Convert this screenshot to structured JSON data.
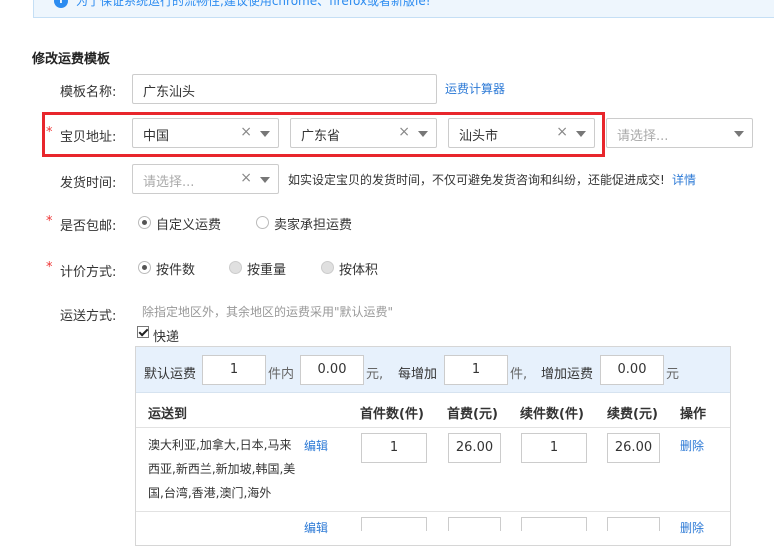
{
  "notice": {
    "text": "为了保证系统运行的流畅性,建议使用chrome、firefox或者新版ie!"
  },
  "section": {
    "title": "修改运费模板"
  },
  "form": {
    "template_name": {
      "label": "模板名称:",
      "value": "广东汕头",
      "link": "运费计算器"
    },
    "location": {
      "required_mark": "*",
      "label": "宝贝地址:",
      "country": "中国",
      "province": "广东省",
      "city": "汕头市",
      "district_placeholder": "请选择..."
    },
    "ship_time": {
      "label": "发货时间:",
      "placeholder": "请选择...",
      "note": "如实设定宝贝的发货时间，不仅可避免发货咨询和纠纷，还能促进成交!",
      "link": "详情"
    },
    "free_shipping": {
      "required_mark": "*",
      "label": "是否包邮:",
      "options": [
        "自定义运费",
        "卖家承担运费"
      ],
      "selected": 0
    },
    "pricing": {
      "required_mark": "*",
      "label": "计价方式:",
      "options": [
        "按件数",
        "按重量",
        "按体积"
      ],
      "selected": 0
    },
    "shipping_method": {
      "label": "运送方式:",
      "hint": "除指定地区外，其余地区的运费采用\"默认运费\"",
      "express_label": "快递",
      "express_checked": true
    }
  },
  "panel": {
    "default": {
      "label": "默认运费",
      "first_qty": "1",
      "unit_pieces": "件内",
      "first_fee": "0.00",
      "unit_yuan": "元,",
      "increase_label": "每增加",
      "add_qty": "1",
      "unit_piece": "件,",
      "add_fee_label": "增加运费",
      "add_fee": "0.00",
      "unit_yuan2": "元"
    },
    "headers": [
      "运送到",
      "首件数(件)",
      "首费(元)",
      "续件数(件)",
      "续费(元)",
      "操作"
    ],
    "rows": [
      {
        "regions": "澳大利亚,加拿大,日本,马来西亚,新西兰,新加坡,韩国,美国,台湾,香港,澳门,海外",
        "edit": "编辑",
        "first_qty": "1",
        "first_fee": "26.00",
        "add_qty": "1",
        "add_fee": "26.00",
        "delete": "删除"
      },
      {
        "edit": "编辑",
        "delete": "删除"
      }
    ]
  }
}
